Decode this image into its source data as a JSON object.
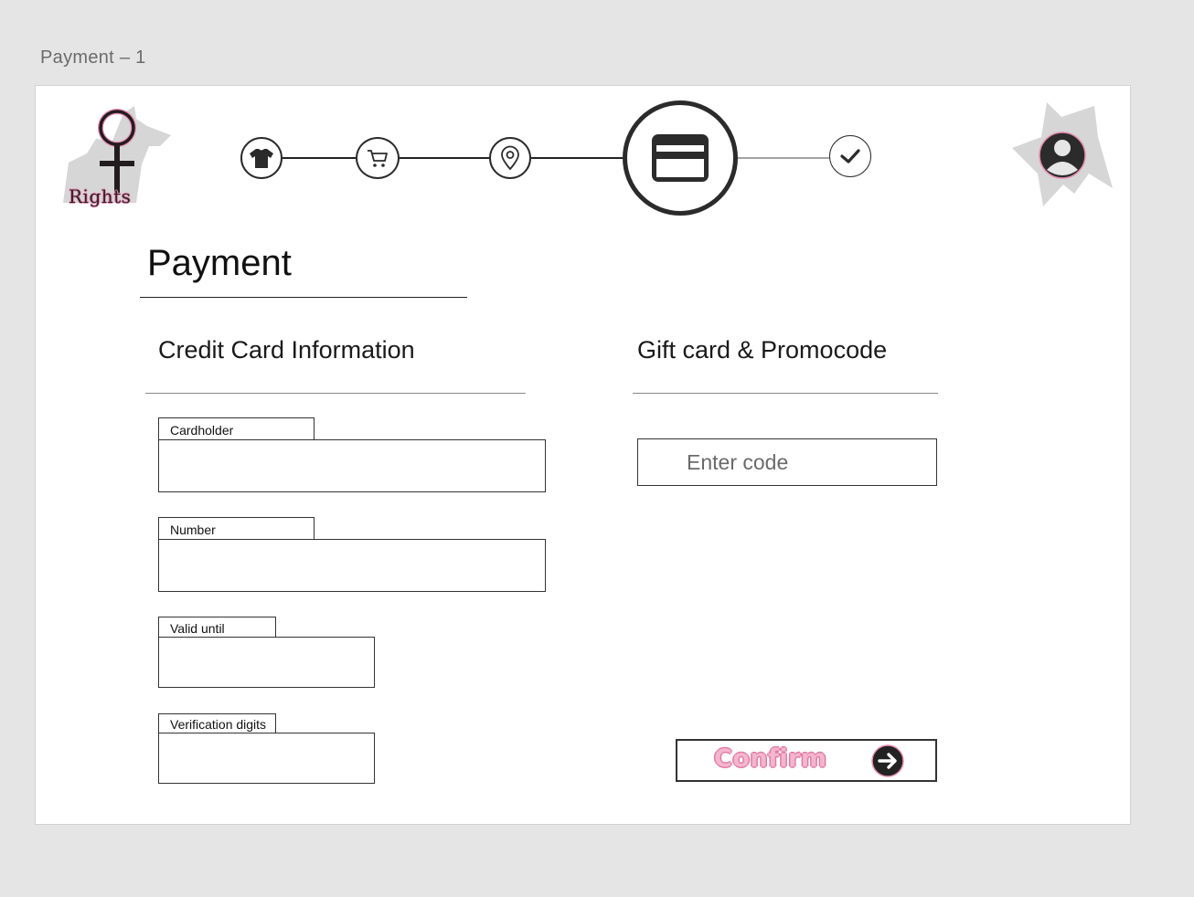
{
  "frame": {
    "label": "Payment – 1"
  },
  "brand": {
    "logo_text": "Rights"
  },
  "stepper": {
    "steps": [
      {
        "icon": "shirt-icon",
        "state": "done"
      },
      {
        "icon": "cart-icon",
        "state": "done"
      },
      {
        "icon": "location-pin-icon",
        "state": "done"
      },
      {
        "icon": "credit-card-icon",
        "state": "current"
      },
      {
        "icon": "checkmark-icon",
        "state": "upcoming"
      }
    ]
  },
  "header": {
    "avatar_icon": "user-avatar-icon"
  },
  "page": {
    "title": "Payment"
  },
  "credit_card": {
    "section_title": "Credit Card Information",
    "fields": {
      "cardholder": {
        "label": "Cardholder",
        "value": ""
      },
      "number": {
        "label": "Number",
        "value": ""
      },
      "valid_until": {
        "label": "Valid until",
        "value": ""
      },
      "verification": {
        "label": "Verification digits",
        "value": ""
      }
    }
  },
  "gift_card": {
    "section_title": "Gift card & Promocode",
    "code_placeholder": "Enter code",
    "code_value": ""
  },
  "confirm": {
    "label": "Confirm",
    "icon": "arrow-right-circle-icon"
  },
  "colors": {
    "accent_pink": "#e88bb0",
    "dark": "#2b2b2b",
    "shape_gray": "#d6d6d6"
  }
}
